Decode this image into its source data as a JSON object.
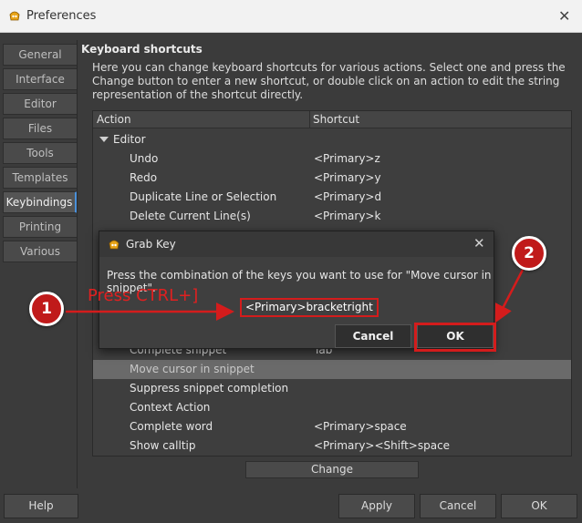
{
  "window": {
    "title": "Preferences",
    "close_glyph": "✕"
  },
  "sidebar": {
    "tabs": [
      {
        "label": "General",
        "active": false
      },
      {
        "label": "Interface",
        "active": false
      },
      {
        "label": "Editor",
        "active": false
      },
      {
        "label": "Files",
        "active": false
      },
      {
        "label": "Tools",
        "active": false
      },
      {
        "label": "Templates",
        "active": false
      },
      {
        "label": "Keybindings",
        "active": true
      },
      {
        "label": "Printing",
        "active": false
      },
      {
        "label": "Various",
        "active": false
      }
    ]
  },
  "keybindings": {
    "section_title": "Keyboard shortcuts",
    "description": "Here you can change keyboard shortcuts for various actions. Select one and press the Change button to enter a new shortcut, or double click on an action to edit the string representation of the shortcut directly.",
    "columns": {
      "action": "Action",
      "shortcut": "Shortcut"
    },
    "group": "Editor",
    "rows": [
      {
        "action": "Undo",
        "shortcut": "<Primary>z"
      },
      {
        "action": "Redo",
        "shortcut": "<Primary>y"
      },
      {
        "action": "Duplicate Line or Selection",
        "shortcut": "<Primary>d"
      },
      {
        "action": "Delete Current Line(s)",
        "shortcut": "<Primary>k"
      },
      {
        "action": "Complete snippet",
        "shortcut": "Tab"
      },
      {
        "action": "Move cursor in snippet",
        "shortcut": ""
      },
      {
        "action": "Suppress snippet completion",
        "shortcut": ""
      },
      {
        "action": "Context Action",
        "shortcut": ""
      },
      {
        "action": "Complete word",
        "shortcut": "<Primary>space"
      },
      {
        "action": "Show calltip",
        "shortcut": "<Primary><Shift>space"
      }
    ],
    "selected_row": "Move cursor in snippet",
    "change_label": "Change"
  },
  "footer": {
    "help_label": "Help",
    "apply_label": "Apply",
    "cancel_label": "Cancel",
    "ok_label": "OK"
  },
  "dialog": {
    "title": "Grab Key",
    "close_glyph": "✕",
    "prompt": "Press the combination of the keys you want to use for \"Move cursor in snippet\".",
    "key_value": "<Primary>bracketright",
    "cancel_label": "Cancel",
    "ok_label": "OK"
  },
  "annotations": {
    "step1": "1",
    "step2": "2",
    "instruction": "Press CTRL+]",
    "color": "#d41c1c"
  }
}
